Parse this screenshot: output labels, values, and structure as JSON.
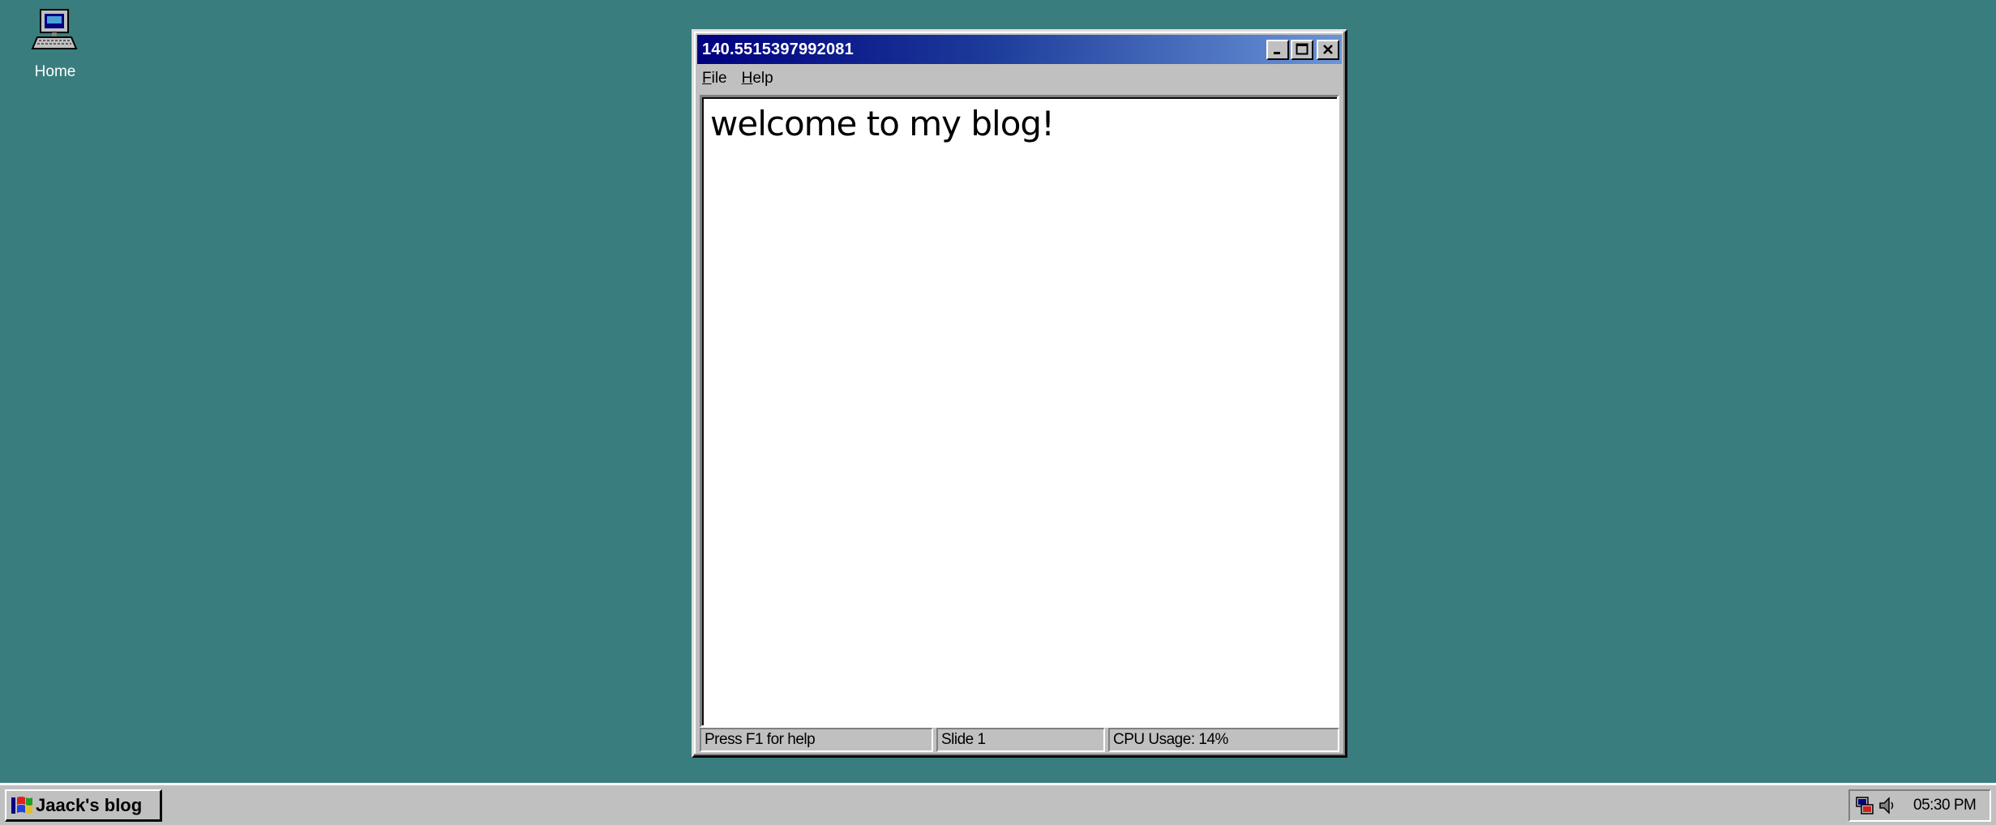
{
  "desktop": {
    "icons": [
      {
        "label": "Home",
        "icon": "computer-icon"
      }
    ]
  },
  "window": {
    "title": "140.5515397992081",
    "menu": [
      {
        "label": "File"
      },
      {
        "label": "Help"
      }
    ],
    "content_text": "welcome to my blog!",
    "status": {
      "help": "Press F1 for help",
      "slide": "Slide 1",
      "cpu": "CPU Usage: 14%"
    },
    "buttons": {
      "minimize_icon": "minimize-icon",
      "maximize_icon": "maximize-icon",
      "close_icon": "close-icon"
    }
  },
  "taskbar": {
    "start_label": "Jaack's blog",
    "start_icon": "windows-logo-icon",
    "tray_icons": [
      "network-icon",
      "speaker-icon"
    ],
    "clock": "05:30 PM"
  },
  "colors": {
    "desktop": "#3a7d7f",
    "titlebar_start": "#000080",
    "titlebar_end": "#6b95d8",
    "chrome": "#c0c0c0"
  }
}
